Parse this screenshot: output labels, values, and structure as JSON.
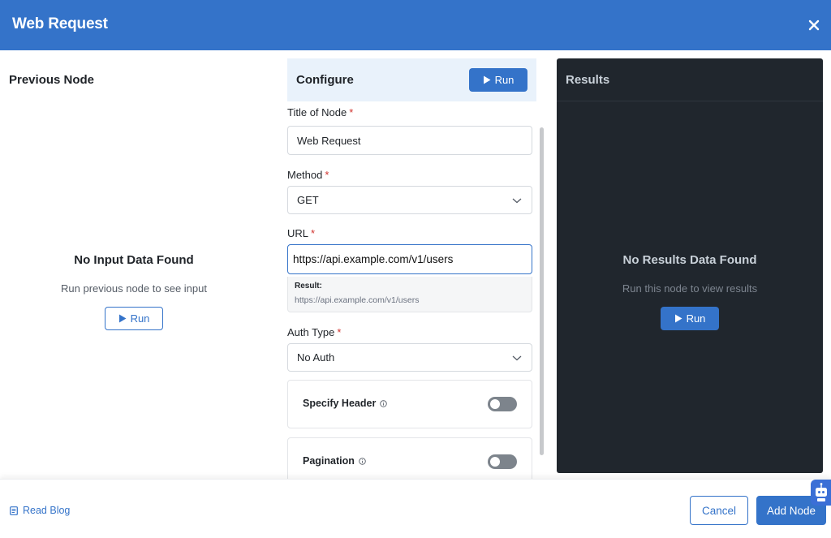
{
  "modal": {
    "title": "Web Request",
    "close_icon": "close-icon"
  },
  "previous": {
    "heading": "Previous Node",
    "empty_title": "No Input Data Found",
    "empty_sub": "Run previous node to see input",
    "run_label": "Run"
  },
  "configure": {
    "heading": "Configure",
    "run_label": "Run",
    "title_label": "Title of Node",
    "title_value": "Web Request",
    "method_label": "Method",
    "method_value": "GET",
    "url_label": "URL",
    "url_value": "https://api.example.com/v1/users",
    "result_label": "Result:",
    "result_value": "https://api.example.com/v1/users",
    "auth_label": "Auth Type",
    "auth_value": "No Auth",
    "specify_header_label": "Specify Header",
    "specify_header_on": false,
    "pagination_label": "Pagination",
    "pagination_on": false,
    "required_mark": "*"
  },
  "results": {
    "heading": "Results",
    "empty_title": "No Results Data Found",
    "empty_sub": "Run this node to view results",
    "run_label": "Run"
  },
  "footer": {
    "blog_label": "Read Blog",
    "cancel_label": "Cancel",
    "add_label": "Add Node"
  },
  "colors": {
    "primary": "#3473c9",
    "dark_panel": "#20262d",
    "required": "#d1342f"
  }
}
